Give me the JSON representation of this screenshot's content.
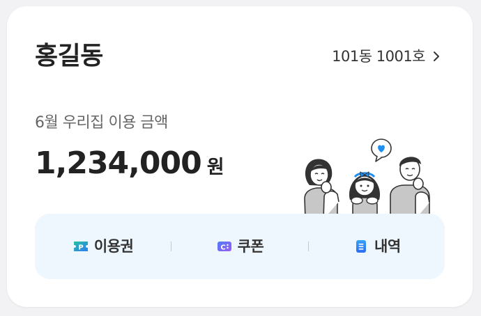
{
  "header": {
    "name": "홍길동",
    "unit_label": "101동 1001호"
  },
  "usage": {
    "label": "6월 우리집 이용 금액",
    "amount": "1,234,000",
    "currency": "원"
  },
  "actions": [
    {
      "label": "이용권",
      "icon": "parking-ticket-icon"
    },
    {
      "label": "쿠폰",
      "icon": "coupon-icon"
    },
    {
      "label": "내역",
      "icon": "history-icon"
    }
  ],
  "colors": {
    "card_background": "#ffffff",
    "action_bar_background": "#eef7fd",
    "heart_accent": "#1f8ef1",
    "text_primary": "#222222",
    "text_secondary": "#666666"
  }
}
